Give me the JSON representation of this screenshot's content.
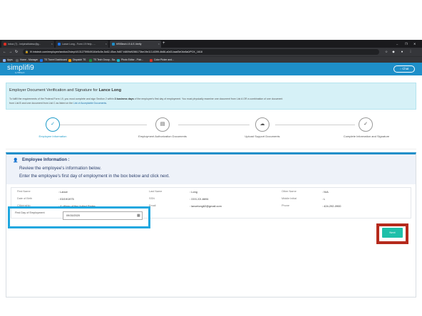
{
  "browser": {
    "tabs": [
      {
        "title": "Inbox (7) - helpinstituteso@g...",
        "active": false,
        "color": "#d93025"
      },
      {
        "title": "Lance Long - Form I-9 Help - ...",
        "active": false,
        "color": "#1a73e8"
      },
      {
        "title": "HRIStech I-9 & E-Verify",
        "active": true,
        "color": "#1e8fc9"
      }
    ],
    "new_tab": "+",
    "window_controls": [
      "–",
      "❐",
      "✕"
    ],
    "url": "i9.hristech.com/employee/section2/step/4/1312759549184e5c5e-5c62-45ce-9d57-f4809d9286173be19e113-6399-4b88-a0d3-baaf3e04e8a0/PCK_1618",
    "bookmarks": [
      {
        "label": "Apps",
        "color": "#8ab4f8"
      },
      {
        "label": "Home - Manager",
        "color": "#5f6368"
      },
      {
        "label": "TS Travel Dashboard",
        "color": "#1a73e8"
      },
      {
        "label": "Dispatch TS",
        "color": "#f29900"
      },
      {
        "label": "TS Tech Group - Sa...",
        "color": "#1e8e3e"
      },
      {
        "label": "Photo Editor - Pixlr...",
        "color": "#12b5cb"
      },
      {
        "label": "Color Picker and...",
        "color": "#d93025"
      }
    ]
  },
  "header": {
    "logo": "simplifi9",
    "logo_sub": "by HRIStech",
    "chat": "Chat"
  },
  "banner": {
    "title_prefix": "Employer Document Verification and Signature for ",
    "employee_name": "Lance Long",
    "text_a": "To fulfill the requirements of the Federal Form I-9, you must complete and sign Section 2 within ",
    "text_b": "3 business days",
    "text_c": " of the employee's first day of employment. You must physically examine one document from List A OR a combination of one document",
    "text_d": "from List B and one document from List C as listed on the ",
    "text_link": "List of Acceptable Documents",
    "text_e": "."
  },
  "steps": [
    {
      "label": "Employee Information",
      "icon": "✓",
      "active": true
    },
    {
      "label": "Employment Authorization Documents",
      "icon": "▤",
      "active": false
    },
    {
      "label": "Upload Support Documents",
      "icon": "☁",
      "active": false
    },
    {
      "label": "Complete Information and Signature",
      "icon": "✓",
      "active": false
    }
  ],
  "card": {
    "icon": "person-icon",
    "title": "Employee Information :",
    "line1": "Review the employee's information below.",
    "line2": "Enter the employee's first day of employment in the box below and click next."
  },
  "fields": {
    "first_name_label": "First Name",
    "first_name": "Lance",
    "last_name_label": "Last Name",
    "last_name": "Long",
    "other_name_label": "Other Name",
    "other_name": "N/A",
    "dob_label": "Date of Birth",
    "dob": "03/19/1975",
    "ssn_label": "SSN",
    "ssn": "XXX-XX-6694",
    "middle_label": "Middle Initial",
    "middle": "L",
    "citizenship_label": "Citizenship",
    "citizenship": "A citizen of the United States",
    "email_label": "Email",
    "email": "lancelong62@gmail.com",
    "phone_label": "Phone",
    "phone": "424-292-0900",
    "fde_label": "First Day of Employment",
    "fde_value": "09/15/2020"
  },
  "next_label": "Next",
  "colors": {
    "brand": "#1e8fc9",
    "next": "#1fbfa9",
    "highlight_blue": "#1fa7df",
    "highlight_red": "#b52a1c"
  }
}
